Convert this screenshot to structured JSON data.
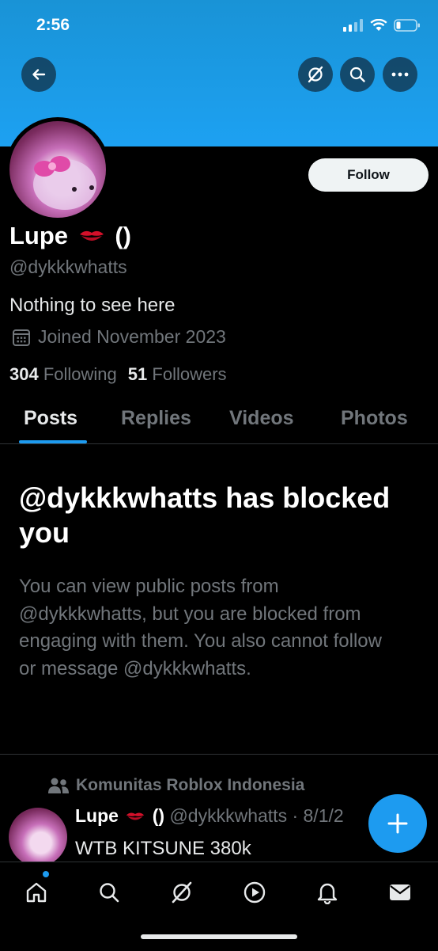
{
  "status_bar": {
    "time": "2:56"
  },
  "profile": {
    "name": "Lupe",
    "name_suffix": "()",
    "handle": "@dykkkwhatts",
    "bio": "Nothing to see here",
    "joined": "Joined November 2023",
    "following_count": "304",
    "following_label": "Following",
    "followers_count": "51",
    "followers_label": "Followers",
    "follow_button": "Follow"
  },
  "tabs": [
    {
      "label": "Posts",
      "active": true
    },
    {
      "label": "Replies",
      "active": false
    },
    {
      "label": "Videos",
      "active": false
    },
    {
      "label": "Photos",
      "active": false
    }
  ],
  "blocked": {
    "title": "@dykkkwhatts has blocked you",
    "message": "You can view public posts from @dykkkwhatts, but you are blocked from engaging with them. You also cannot follow or message @dykkkwhatts."
  },
  "post": {
    "community": "Komunitas Roblox Indonesia",
    "author_name": "Lupe",
    "author_suffix": "()",
    "author_handle": "@dykkkwhatts",
    "date": "· 8/1/2",
    "text": "WTB KITSUNE 380k"
  },
  "icons": {
    "back": "arrow-left-icon",
    "grok": "grok-icon",
    "search": "search-icon",
    "more": "more-icon",
    "calendar": "calendar-icon",
    "community": "community-icon",
    "compose": "plus-icon",
    "nav": [
      "home-icon",
      "search-icon",
      "grok-icon",
      "video-icon",
      "bell-icon",
      "mail-icon"
    ]
  },
  "colors": {
    "accent": "#1d9bf0",
    "banner": "#1da1f2",
    "muted": "#71767b"
  }
}
